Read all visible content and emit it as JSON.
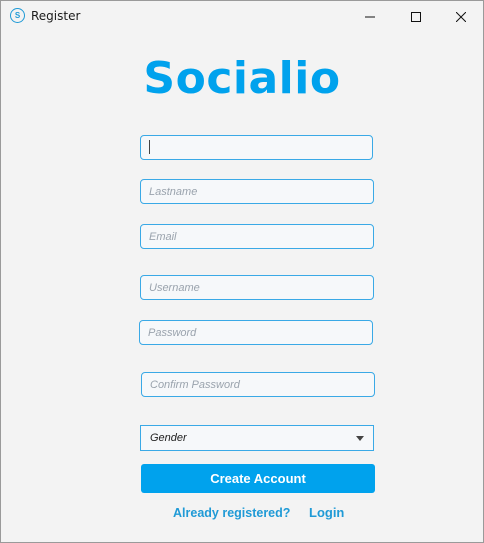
{
  "window": {
    "title": "Register",
    "icon": "app-icon",
    "controls": [
      "minimize-icon",
      "maximize-icon",
      "close-icon"
    ]
  },
  "logo": {
    "text": "Socialio",
    "color": "#00a2ed"
  },
  "form": {
    "firstname": {
      "value": "",
      "placeholder": ""
    },
    "lastname": {
      "value": "",
      "placeholder": "Lastname"
    },
    "email": {
      "value": "",
      "placeholder": "Email"
    },
    "username": {
      "value": "",
      "placeholder": "Username"
    },
    "password": {
      "value": "",
      "placeholder": "Password"
    },
    "confirm_password": {
      "value": "",
      "placeholder": "Confirm Password"
    },
    "gender": {
      "selected": "Gender"
    },
    "create_label": "Create Account"
  },
  "footer": {
    "prompt": "Already registered?",
    "login_label": "Login"
  },
  "colors": {
    "accent": "#00a2ed",
    "border": "#3aa9e6",
    "background": "#f3f3f3"
  }
}
